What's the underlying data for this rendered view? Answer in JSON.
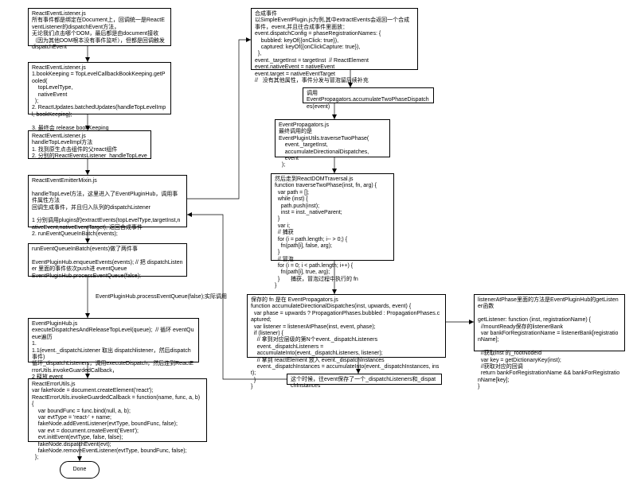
{
  "nodes": {
    "n1": "ReactEventListener.js\n所有事件都是绑定在Document上，回调统一是ReactEventListener的dispatchEvent方法，\n无论我们点击哪个DOM，最后都是由document接收（因为其他DOM根本没有事件监听），但都是回调触发dispatchEvent",
    "n2": "ReactEventListener.js\n1.bookKeeping = TopLevelCallbackBookKeeping.getPooled(\n    topLevelType,\n    nativeEvent\n  );\n2. ReactUpdates.batchedUpdates(handleTopLevelImpl, bookKeeping);\n\n3. 最终会 release bookKeeping",
    "n3": "ReactEventListener.js\nhandleTopLevelImpl方法\n1. 找到原生点击组件的父react组件\n2. 分别的ReactEventsListener_handleTopLeve",
    "n4": "ReactEventEmitterMixin.js\n\nhandleTopLevel方法，这里进入了EventPluginHub，调用事件属性方法\n回调生成事件，并且归入队列的dispatchListener\n\n1 分别调用plugins的extractEvents(topLevelType,targetInst,nativeEvent,nativeEventTarget), 返回合成事件\n2. runEventQueueInBatch(events);",
    "n5": "runEventQueueInBatch(events)做了两件事\n\nEventPluginHub.enqueueEvents(events); // 把 dispatchListener 里面的事件依次push进 eventQueue\nEventPluginHub.processEventQueue(false);",
    "n6": "EventPluginHub.js\nexecuteDispatchesAndReleaseTopLevel(queue);  // 循环 eventQueue遍历\n1.\n1.1(event._dispatchListener 取出 dispatchlistener，然后dispatch事件)\n循环_dispatchListeners，调用executeDispatch，然后连到ReactErrorUtils.invokeGuardedCallback，\n2 释放 event",
    "n7": "ReactErrorUtils.js\nvar fakeNode = document.createElement('react');\nReactErrorUtils.invokeGuardedCallback = function(name, func, a, b) {\n    var boundFunc = func.bind(null, a, b);\n    var evtType = 'react-' + name;\n    fakeNode.addEventListener(evtType, boundFunc, false);\n    var evt = document.createEvent('Event');\n    evt.initEvent(evtType, false, false);\n    fakeNode.dispatchEvent(evt);\n    fakeNode.removeEventListener(evtType, boundFunc, false);\n  };",
    "n8": "Done",
    "n9": "合成事件\n以SimpleEventPlugin.js为例,其中extractEvents会返回一个合成事件，event,并且往合成事件里面放：\nevent.dispatchConfig = phaseRegistrationNames: {\n    bubbled: keyOf({onClick: true}),\n    captured: keyOf({onClickCapture: true}),\n  },\nevent._targetInst = targetInst  // ReactElement\nevent.nativeEvent = nativeEvent\nevent.target = nativeEventTarget\n//   没有其他属性，事件分发与冒泡留后续补充",
    "n10": "调用\nEventPropagators.accumulateTwoPhaseDispatches(event)",
    "n11": "EventPropagators.js\n最终调用的是\nEventPluginUtils.traverseTwoPhase(\n    event._targetInst,\n    accumulateDirectionalDispatches,\n    event\n  );",
    "n12": "然后走到ReactDOMTraversal.js\nfunction traverseTwoPhase(inst, fn, arg) {\n  var path = [];\n  while (inst) {\n    path.push(inst);\n    inst = inst._nativeParent;\n  }\n  var i;\n  // 捕获\n  for (i = path.length; i-- > 0;) {\n    fn(path[i], false, arg);\n  }\n  // 冒泡\n  for (i = 0; i < path.length; i++) {\n    fn(path[i], true, arg);\n  }\n}",
    "n13": "保存的 fn 是在 EventPropagators.js\nfunction accumulateDirectionalDispatches(inst, upwards, event) {\n  var phase = upwards ? PropagationPhases.bubbled : PropagationPhases.captured;\n  var listener = listenerAtPhase(inst, event, phase);\n  if (listener) {\n    // 拿到对应层级的第N个event._dispatchListeners\n    event._dispatchListeners =\n    accumulateInto(event._dispatchListeners, listener);\n    // 拿到 reactElement 放入 event._dispatchInstances\n    event._dispatchInstances = accumulateInto(event._dispatchInstances, inst);\n  }\n}",
    "n14": "这个时候，往event保存了一个_dispatchListeners和_dispatchInstances",
    "n15": "listenerAtPhase里面的方法是EventPluginHub的getListener函数\n\ngetListener: function (inst, registrationName) {\n  //mountReady保存的listenerBank\n  var bankForRegistrationName = listenerBank[registrationName];\n\n  //获取inst 的_rootNodeId\n  var key = getDictionaryKey(inst);\n  //获取对应的回调\n  return bankForRegistrationName && bankForRegistrationName[key];\n}",
    "label1": "EventPluginHub.processEventQueue(false);实际调用",
    "label2": "捕获，冒泡过程中执行的 fn"
  }
}
